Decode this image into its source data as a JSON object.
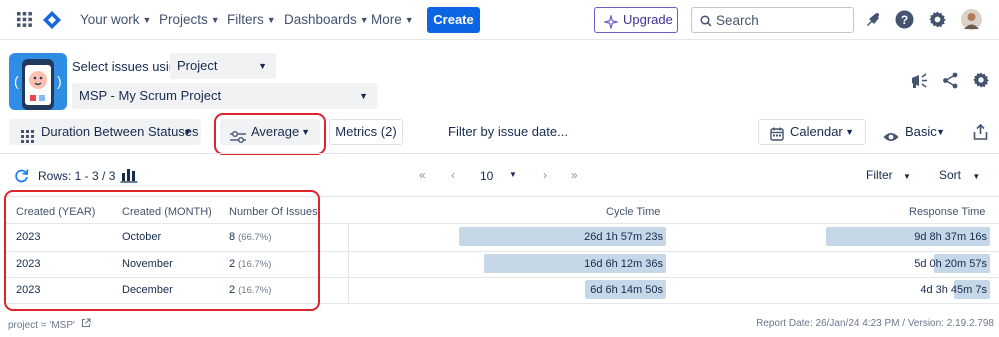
{
  "topnav": {
    "items": [
      {
        "label": "Your work"
      },
      {
        "label": "Projects"
      },
      {
        "label": "Filters"
      },
      {
        "label": "Dashboards"
      },
      {
        "label": "More"
      }
    ],
    "create_label": "Create",
    "upgrade_label": "Upgrade",
    "search_placeholder": "Search",
    "colors": {
      "brand": "#0c66e4",
      "upgrade_border": "#6e5dc6"
    }
  },
  "app": {
    "select_issues_label": "Select issues using",
    "source_select_value": "Project",
    "project_select_value": "MSP - My Scrum Project"
  },
  "toolbar": {
    "report_type": "Duration Between Statuses",
    "aggregation": "Average",
    "metrics_label": "Metrics (2)",
    "filter_date_label": "Filter by issue date...",
    "calendar_label": "Calendar",
    "view_label": "Basic"
  },
  "gridbar": {
    "rows_label": "Rows: 1 - 3 / 3",
    "page_size": "10",
    "filter_label": "Filter",
    "sort_label": "Sort"
  },
  "table": {
    "columns": [
      "Created (YEAR)",
      "Created (MONTH)",
      "Number Of Issues",
      "Cycle Time",
      "Response Time"
    ],
    "rows": [
      {
        "year": "2023",
        "month": "October",
        "count": "8",
        "pct": "(66.7%)",
        "cycle": "26d 1h 57m 23s",
        "cycle_frac": 1.0,
        "response": "9d 8h 37m 16s",
        "response_frac": 1.0
      },
      {
        "year": "2023",
        "month": "November",
        "count": "2",
        "pct": "(16.7%)",
        "cycle": "16d 6h 12m 36s",
        "cycle_frac": 0.88,
        "response": "5d 0h 20m 57s",
        "response_frac": 0.34
      },
      {
        "year": "2023",
        "month": "December",
        "count": "2",
        "pct": "(16.7%)",
        "cycle": "6d 6h 14m 50s",
        "cycle_frac": 0.39,
        "response": "4d 3h 45m 7s",
        "response_frac": 0.22
      }
    ]
  },
  "footer": {
    "jql": "project = 'MSP'",
    "report_info": "Report Date: 26/Jan/24 4:23 PM / Version: 2.19.2.798"
  }
}
